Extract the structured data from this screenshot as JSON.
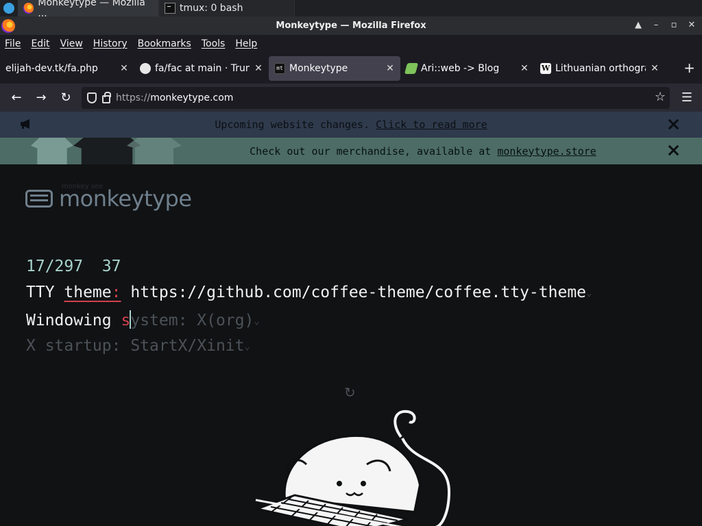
{
  "taskbar": {
    "tasks": [
      {
        "label": "Monkeytype — Mozilla ...",
        "icon": "firefox-icon"
      },
      {
        "label": "tmux: 0 bash",
        "icon": "terminal-icon"
      }
    ]
  },
  "window": {
    "title": "Monkeytype — Mozilla Firefox"
  },
  "menu": [
    "File",
    "Edit",
    "View",
    "History",
    "Bookmarks",
    "Tools",
    "Help"
  ],
  "tabs": [
    {
      "label": "elijah-dev.tk/fa.php",
      "icon": "none"
    },
    {
      "label": "fa/fac at main · Trunc",
      "icon": "github-icon"
    },
    {
      "label": "Monkeytype",
      "icon": "monkeytype-icon"
    },
    {
      "label": "Ari::web -> Blog",
      "icon": "ari-icon"
    },
    {
      "label": "Lithuanian orthograp",
      "icon": "wikipedia-icon"
    }
  ],
  "nav": {
    "url_scheme": "https://",
    "url_host": "monkeytype.com"
  },
  "notices": {
    "website_changes": "Upcoming website changes.",
    "website_changes_link": "Click to read more",
    "merch": "Check out our merchandise, available at",
    "merch_link": "monkeytype.store"
  },
  "logo": {
    "small": "monkey see",
    "text": "monkeytype"
  },
  "test": {
    "progress": "17/297",
    "wpm": "37",
    "line1_a": "TTY ",
    "line1_err": "theme",
    "line1_err_colon": ":",
    "line1_b": " https://github.com/coffee-theme/coffee.tty-theme",
    "line2_a": "Windowing ",
    "line2_err": "s",
    "line2_rest": "ystem: X(org)",
    "line3": "X startup: StartX/Xinit"
  },
  "colors": {
    "accent": "#a7d3cc",
    "error": "#d3414d",
    "sub": "#4b5258"
  }
}
